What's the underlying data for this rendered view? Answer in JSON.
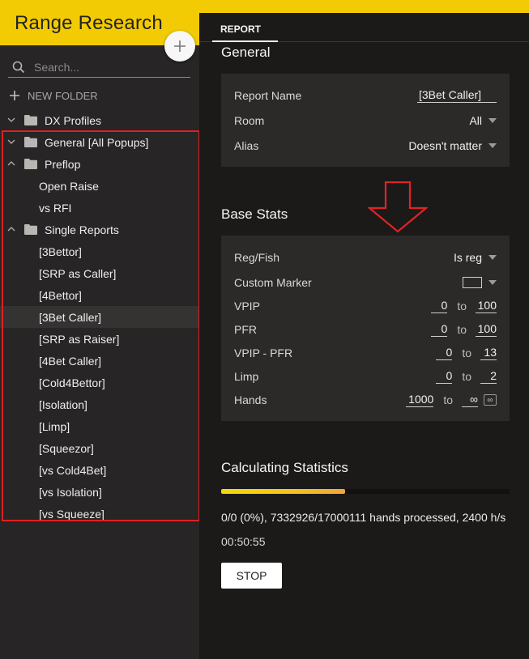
{
  "app": {
    "title": "Range Research"
  },
  "sidebar": {
    "search_placeholder": "Search...",
    "new_folder_label": "NEW FOLDER",
    "tree": [
      {
        "label": "DX Profiles",
        "type": "folder",
        "expanded": false,
        "active": false
      },
      {
        "label": "General [All Popups]",
        "type": "folder",
        "expanded": false,
        "active": false
      },
      {
        "label": "Preflop",
        "type": "folder",
        "expanded": true,
        "active": false
      },
      {
        "label": "Open Raise",
        "type": "leaf",
        "active": false
      },
      {
        "label": "vs RFI",
        "type": "leaf",
        "active": false
      },
      {
        "label": "Single Reports",
        "type": "folder",
        "expanded": true,
        "active": false
      },
      {
        "label": "[3Bettor]",
        "type": "leaf",
        "active": false
      },
      {
        "label": "[SRP as Caller]",
        "type": "leaf",
        "active": false
      },
      {
        "label": "[4Bettor]",
        "type": "leaf",
        "active": false
      },
      {
        "label": "[3Bet Caller]",
        "type": "leaf",
        "active": true
      },
      {
        "label": "[SRP as Raiser]",
        "type": "leaf",
        "active": false
      },
      {
        "label": "[4Bet Caller]",
        "type": "leaf",
        "active": false
      },
      {
        "label": "[Cold4Bettor]",
        "type": "leaf",
        "active": false
      },
      {
        "label": "[Isolation]",
        "type": "leaf",
        "active": false
      },
      {
        "label": "[Limp]",
        "type": "leaf",
        "active": false
      },
      {
        "label": "[Squeezor]",
        "type": "leaf",
        "active": false
      },
      {
        "label": "[vs Cold4Bet]",
        "type": "leaf",
        "active": false
      },
      {
        "label": "[vs Isolation]",
        "type": "leaf",
        "active": false
      },
      {
        "label": "[vs Squeeze]",
        "type": "leaf",
        "active": false
      }
    ]
  },
  "main": {
    "tab_label": "REPORT",
    "general": {
      "title": "General",
      "report_name_label": "Report Name",
      "report_name_value": "[3Bet Caller]",
      "room_label": "Room",
      "room_value": "All",
      "alias_label": "Alias",
      "alias_value": "Doesn't matter"
    },
    "base_stats": {
      "title": "Base Stats",
      "regfish_label": "Reg/Fish",
      "regfish_value": "Is reg",
      "custom_marker_label": "Custom Marker",
      "to_label": "to",
      "vpip": {
        "label": "VPIP",
        "min": "0",
        "max": "100"
      },
      "pfr": {
        "label": "PFR",
        "min": "0",
        "max": "100"
      },
      "vpip_pfr": {
        "label": "VPIP - PFR",
        "min": "0",
        "max": "13"
      },
      "limp": {
        "label": "Limp",
        "min": "0",
        "max": "2"
      },
      "hands": {
        "label": "Hands",
        "min": "1000",
        "max": "∞",
        "inf_button": "∞"
      }
    },
    "calculating": {
      "title": "Calculating Statistics",
      "progress_fraction": 0.43,
      "status_text": "0/0 (0%), 7332926/17000111 hands processed, 2400 h/s",
      "elapsed": "00:50:55",
      "stop_label": "STOP"
    }
  },
  "colors": {
    "brand_yellow": "#f2cb04",
    "sidebar_bg": "#272525",
    "main_bg": "#1b1a19",
    "card_bg": "#2b2a29",
    "highlight_red": "#e02020"
  }
}
